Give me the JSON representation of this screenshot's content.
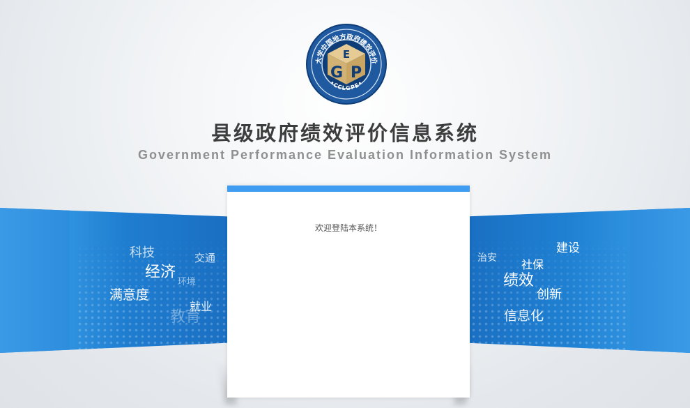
{
  "logo": {
    "ring_text": "兰州大学中国地方政府绩效评价中心",
    "bottom_text": "•CCLGPE•",
    "letters": [
      "E",
      "G",
      "P"
    ],
    "colors": {
      "ring": "#1f5aa0",
      "inner": "#0e3d78",
      "gold": "#d8b878"
    }
  },
  "title": {
    "cn": "县级政府绩效评价信息系统",
    "en": "Government Performance Evaluation Information System"
  },
  "left_keywords": [
    "科技",
    "交通",
    "经济",
    "环境",
    "满意度",
    "就业",
    "教育"
  ],
  "right_keywords": [
    "建设",
    "治安",
    "社保",
    "绩效",
    "创新",
    "信息化"
  ],
  "card": {
    "welcome": "欢迎登陆本系统！",
    "accent": "#3f9cf0"
  }
}
